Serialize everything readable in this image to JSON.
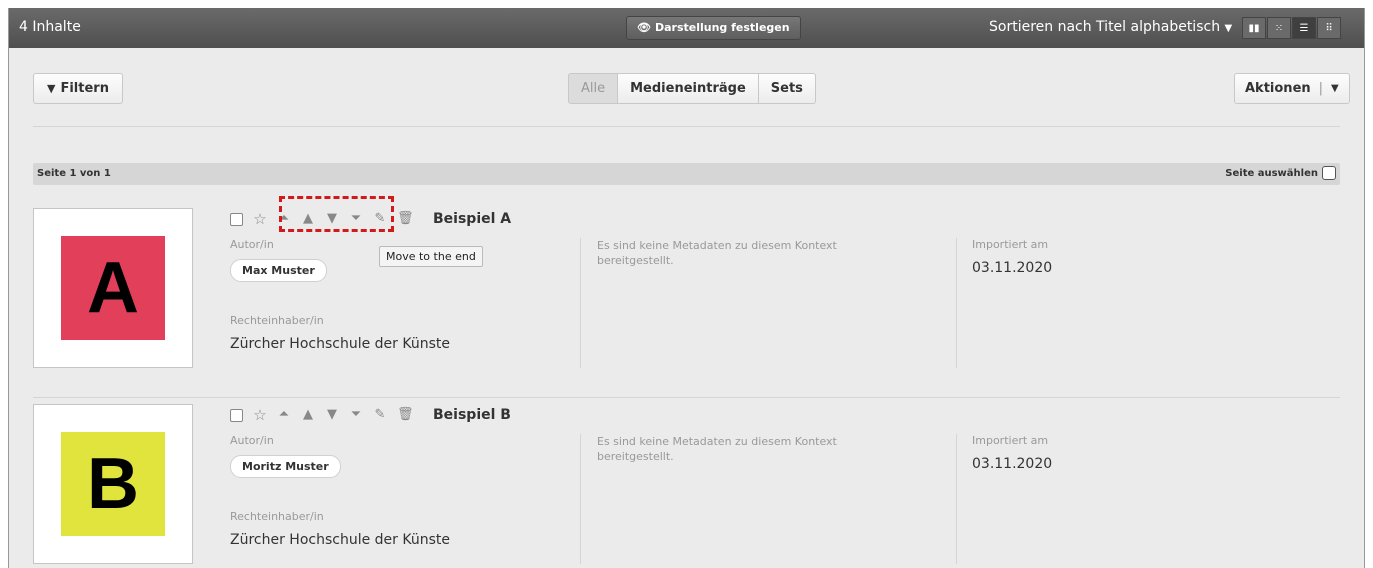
{
  "topbar": {
    "count": "4 Inhalte",
    "display_button": "Darstellung festlegen",
    "sort": "Sortieren nach Titel alphabetisch",
    "view_icons": [
      "tiles-large-icon",
      "tiles-small-icon",
      "list-icon",
      "grid-icon"
    ]
  },
  "filter_label": "Filtern",
  "segments": [
    "Alle",
    "Medieneinträge",
    "Sets"
  ],
  "actions_label": "Aktionen",
  "page_info": "Seite 1 von 1",
  "page_select": "Seite auswählen",
  "tooltip": "Move to the end",
  "items": [
    {
      "letter": "A",
      "color": "#e23f5a",
      "title": "Beispiel A",
      "author_label": "Autor/in",
      "author": "Max Muster",
      "rights_label": "Rechteinhaber/in",
      "rights": "Zürcher Hochschule der Künste",
      "no_meta": "Es sind keine Metadaten zu diesem Kontext bereitgestellt.",
      "imported_label": "Importiert am",
      "imported": "03.11.2020"
    },
    {
      "letter": "B",
      "color": "#e1e43c",
      "title": "Beispiel B",
      "author_label": "Autor/in",
      "author": "Moritz Muster",
      "rights_label": "Rechteinhaber/in",
      "rights": "Zürcher Hochschule der Künste",
      "no_meta": "Es sind keine Metadaten zu diesem Kontext bereitgestellt.",
      "imported_label": "Importiert am",
      "imported": "03.11.2020"
    }
  ]
}
